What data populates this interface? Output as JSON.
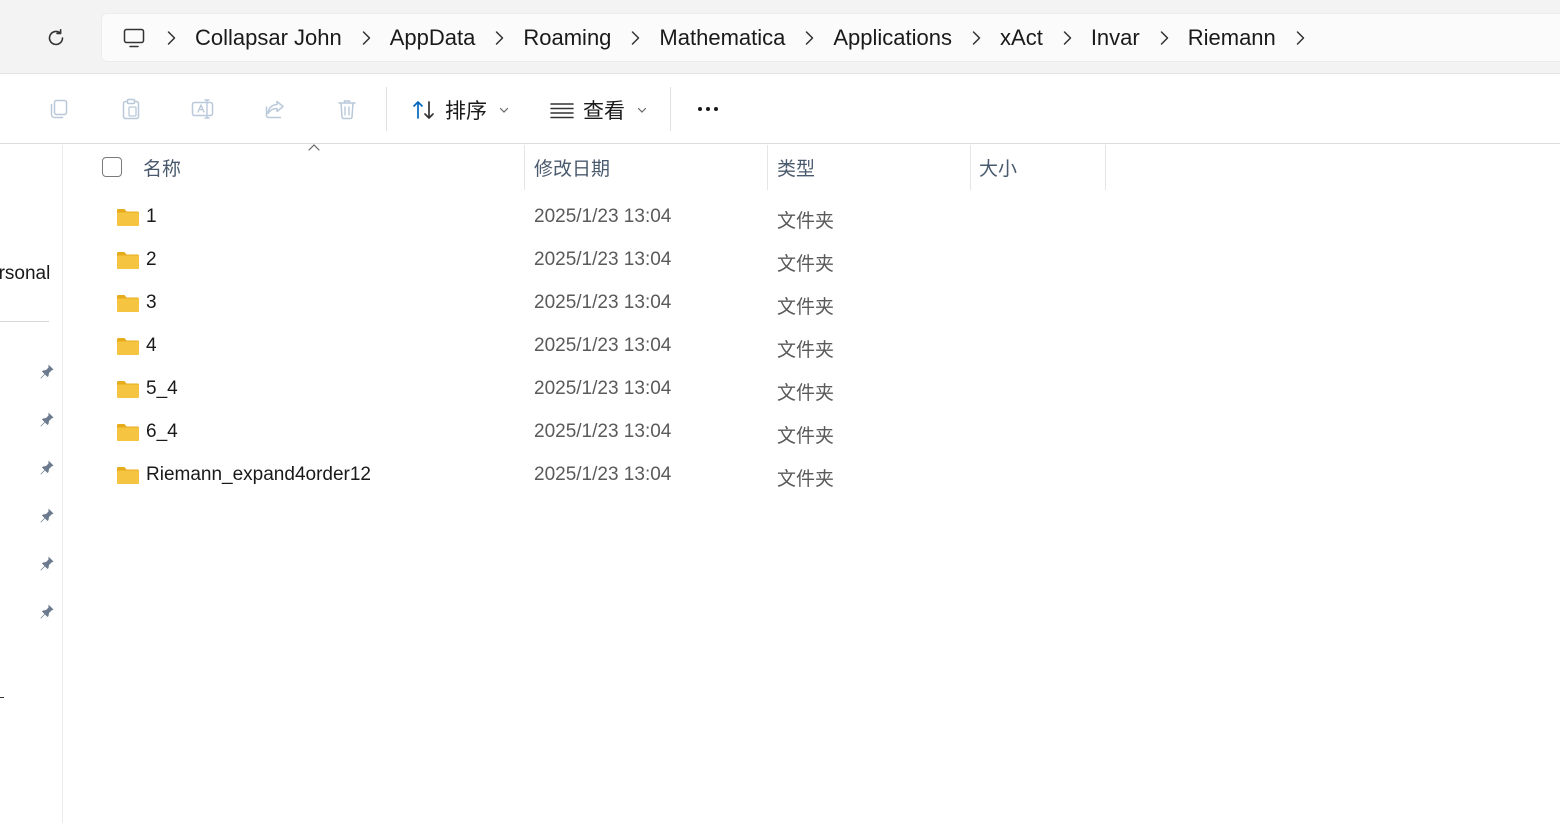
{
  "address_bar": {
    "breadcrumbs": [
      "Collapsar John",
      "AppData",
      "Roaming",
      "Mathematica",
      "Applications",
      "xAct",
      "Invar",
      "Riemann"
    ]
  },
  "toolbar": {
    "sort_label": "排序",
    "view_label": "查看"
  },
  "nav_pane": {
    "partial_label": "ersonal"
  },
  "columns": {
    "name": "名称",
    "date": "修改日期",
    "type": "类型",
    "size": "大小"
  },
  "files": [
    {
      "name": "1",
      "date": "2025/1/23 13:04",
      "type": "文件夹"
    },
    {
      "name": "2",
      "date": "2025/1/23 13:04",
      "type": "文件夹"
    },
    {
      "name": "3",
      "date": "2025/1/23 13:04",
      "type": "文件夹"
    },
    {
      "name": "4",
      "date": "2025/1/23 13:04",
      "type": "文件夹"
    },
    {
      "name": "5_4",
      "date": "2025/1/23 13:04",
      "type": "文件夹"
    },
    {
      "name": "6_4",
      "date": "2025/1/23 13:04",
      "type": "文件夹"
    },
    {
      "name": "Riemann_expand4order12",
      "date": "2025/1/23 13:04",
      "type": "文件夹"
    }
  ],
  "colors": {
    "folder": "#f5c542",
    "accent": "#0067c0"
  }
}
